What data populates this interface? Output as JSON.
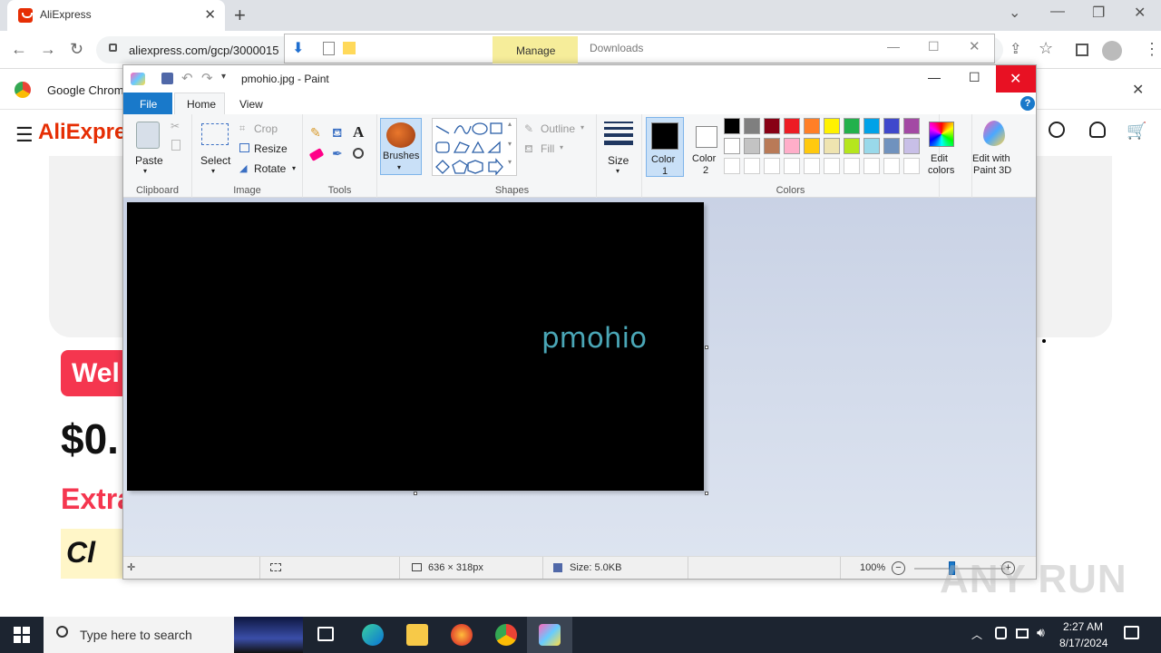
{
  "browser": {
    "tab_title": "AliExpress",
    "url": "aliexpress.com/gcp/3000015",
    "bookmark": "Google Chrom"
  },
  "aliexpress": {
    "logo": "AliExpre",
    "welcome": "Wel",
    "price": "$0.",
    "extra": "Extra",
    "ci": "Cl"
  },
  "downloads_bar": {
    "manage": "Manage",
    "downloads": "Downloads"
  },
  "paint": {
    "window_title": "pmohio.jpg - Paint",
    "tabs": [
      "File",
      "Home",
      "View"
    ],
    "clipboard": {
      "paste": "Paste",
      "label": "Clipboard"
    },
    "image": {
      "select": "Select",
      "crop": "Crop",
      "resize": "Resize",
      "rotate": "Rotate",
      "label": "Image"
    },
    "tools": {
      "label": "Tools"
    },
    "brushes": "Brushes",
    "shapes": {
      "outline": "Outline",
      "fill": "Fill",
      "label": "Shapes"
    },
    "size": "Size",
    "color1": [
      "Color",
      "1"
    ],
    "color2": [
      "Color",
      "2"
    ],
    "colors_label": "Colors",
    "edit_colors": [
      "Edit",
      "colors"
    ],
    "paint3d": [
      "Edit with",
      "Paint 3D"
    ],
    "canvas_text": "pmohio",
    "palette_row1": [
      "#000000",
      "#7f7f7f",
      "#880015",
      "#ed1c24",
      "#ff7f27",
      "#fff200",
      "#22b14c",
      "#00a2e8",
      "#3f48cc",
      "#a349a4"
    ],
    "palette_row2": [
      "#ffffff",
      "#c3c3c3",
      "#b97a57",
      "#ffaec9",
      "#ffc90e",
      "#efe4b0",
      "#b5e61d",
      "#99d9ea",
      "#7092be",
      "#c8bfe7"
    ],
    "status": {
      "dimensions": "636 × 318px",
      "size": "Size: 5.0KB",
      "zoom": "100%"
    }
  },
  "taskbar": {
    "search": "Type here to search",
    "time": "2:27 AM",
    "date": "8/17/2024"
  },
  "watermark": "ANY RUN"
}
